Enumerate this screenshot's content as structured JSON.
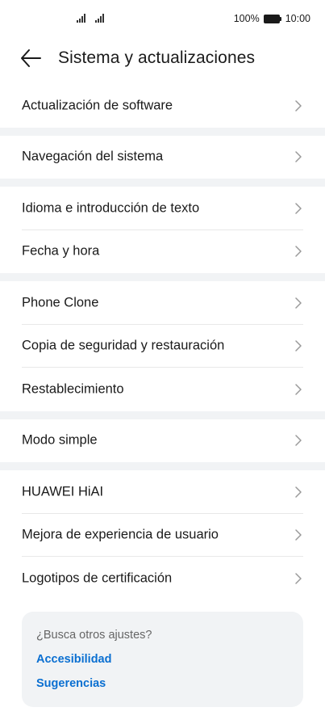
{
  "status_bar": {
    "battery": "100%",
    "time": "10:00"
  },
  "header": {
    "title": "Sistema y actualizaciones"
  },
  "groups": [
    {
      "items": [
        "Actualización de software"
      ]
    },
    {
      "items": [
        "Navegación del sistema"
      ]
    },
    {
      "items": [
        "Idioma e introducción de texto",
        "Fecha y hora"
      ]
    },
    {
      "items": [
        "Phone Clone",
        "Copia de seguridad y restauración",
        "Restablecimiento"
      ]
    },
    {
      "items": [
        "Modo simple"
      ]
    },
    {
      "items": [
        "HUAWEI HiAI",
        "Mejora de experiencia de usuario",
        "Logotipos de certificación"
      ]
    }
  ],
  "suggestions": {
    "question": "¿Busca otros ajustes?",
    "links": [
      "Accesibilidad",
      "Sugerencias"
    ]
  },
  "colors": {
    "link": "#0a6fd1",
    "divider_gap": "#f1f3f5"
  }
}
